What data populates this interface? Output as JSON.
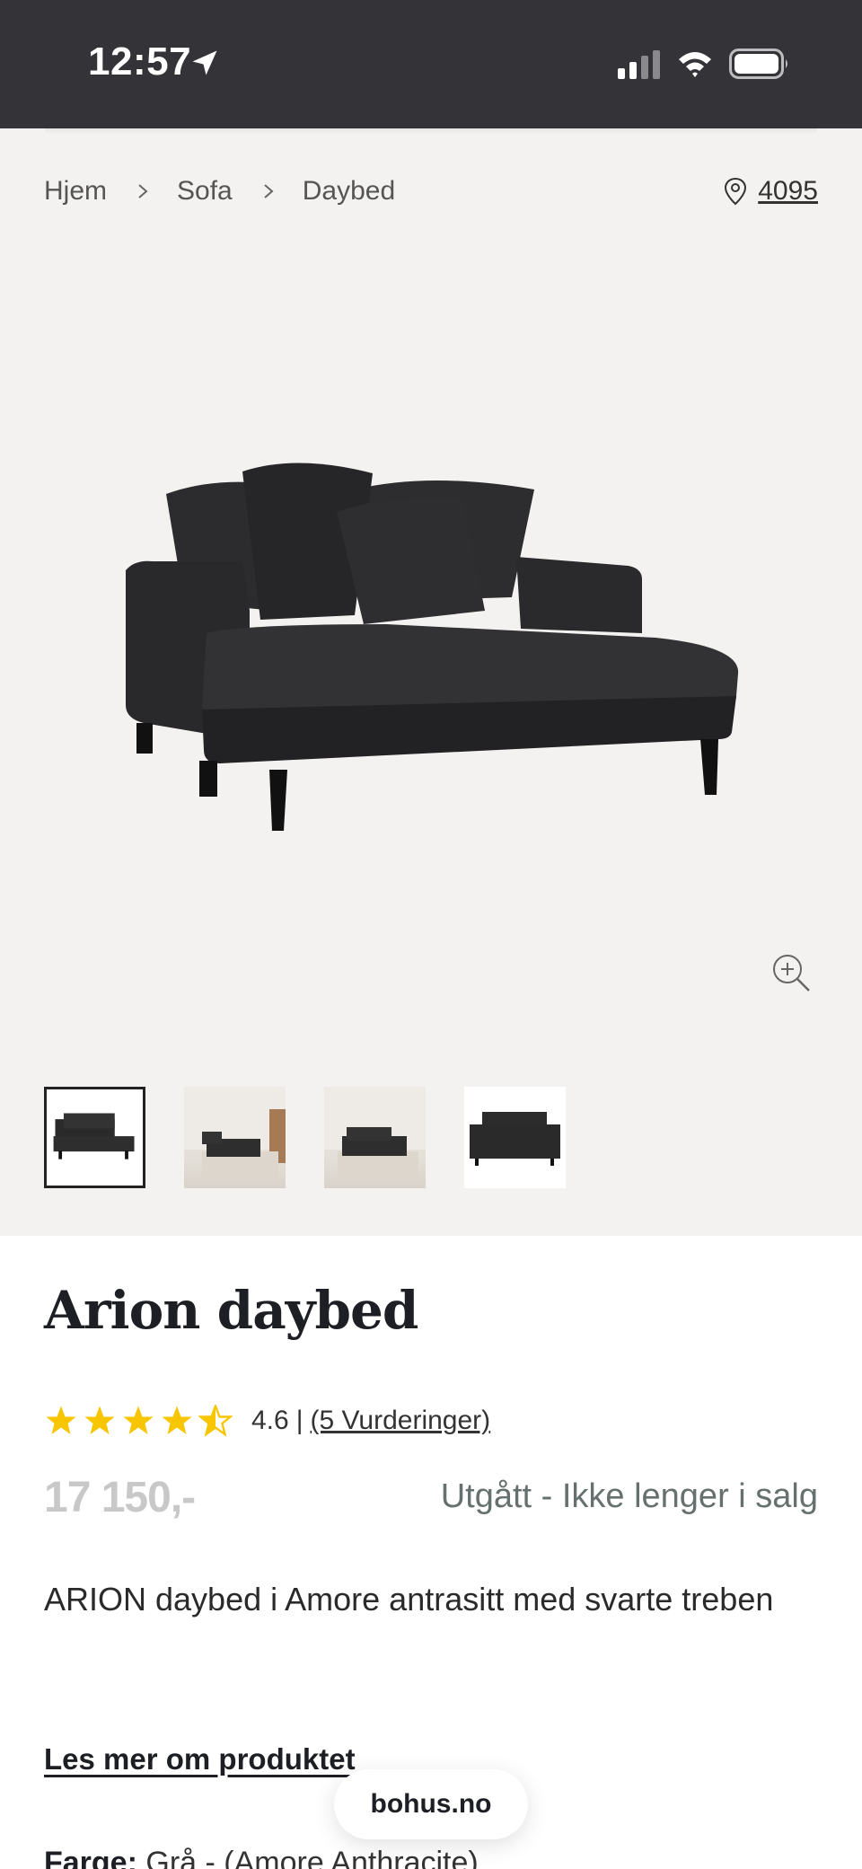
{
  "status_bar": {
    "time": "12:57"
  },
  "breadcrumb": {
    "items": [
      "Hjem",
      "Sofa",
      "Daybed"
    ]
  },
  "store": {
    "number": "4095"
  },
  "product": {
    "title": "Arion daybed",
    "rating": {
      "score": "4.6",
      "separator": "|",
      "count_label": "(5 Vurderinger)",
      "stars": 4.5
    },
    "price": "17 150,-",
    "stock_status": "Utgått - Ikke lenger i salg",
    "description": "ARION daybed i Amore antrasitt med svarte treben",
    "read_more": "Les mer om produktet",
    "color_label": "Farge:",
    "color_value": "Grå - (Amore Anthracite)"
  },
  "gallery": {
    "thumbnail_count": 4,
    "selected_index": 0
  },
  "browser": {
    "domain": "bohus.no"
  },
  "colors": {
    "star": "#f7c600",
    "status_bar": "#333338",
    "gallery_bg": "#f4f2f0",
    "stock_text": "#66706e"
  },
  "icons": [
    "location-arrow-icon",
    "signal-icon",
    "wifi-icon",
    "battery-icon",
    "chevron-right-icon",
    "map-pin-icon",
    "zoom-in-icon",
    "star-icon"
  ]
}
